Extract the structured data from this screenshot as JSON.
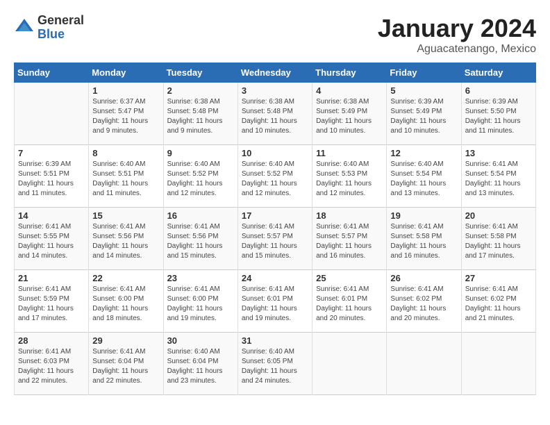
{
  "logo": {
    "general": "General",
    "blue": "Blue"
  },
  "header": {
    "month": "January 2024",
    "location": "Aguacatenango, Mexico"
  },
  "weekdays": [
    "Sunday",
    "Monday",
    "Tuesday",
    "Wednesday",
    "Thursday",
    "Friday",
    "Saturday"
  ],
  "weeks": [
    [
      {
        "day": "",
        "sunrise": "",
        "sunset": "",
        "daylight": ""
      },
      {
        "day": "1",
        "sunrise": "Sunrise: 6:37 AM",
        "sunset": "Sunset: 5:47 PM",
        "daylight": "Daylight: 11 hours and 9 minutes."
      },
      {
        "day": "2",
        "sunrise": "Sunrise: 6:38 AM",
        "sunset": "Sunset: 5:48 PM",
        "daylight": "Daylight: 11 hours and 9 minutes."
      },
      {
        "day": "3",
        "sunrise": "Sunrise: 6:38 AM",
        "sunset": "Sunset: 5:48 PM",
        "daylight": "Daylight: 11 hours and 10 minutes."
      },
      {
        "day": "4",
        "sunrise": "Sunrise: 6:38 AM",
        "sunset": "Sunset: 5:49 PM",
        "daylight": "Daylight: 11 hours and 10 minutes."
      },
      {
        "day": "5",
        "sunrise": "Sunrise: 6:39 AM",
        "sunset": "Sunset: 5:49 PM",
        "daylight": "Daylight: 11 hours and 10 minutes."
      },
      {
        "day": "6",
        "sunrise": "Sunrise: 6:39 AM",
        "sunset": "Sunset: 5:50 PM",
        "daylight": "Daylight: 11 hours and 11 minutes."
      }
    ],
    [
      {
        "day": "7",
        "sunrise": "Sunrise: 6:39 AM",
        "sunset": "Sunset: 5:51 PM",
        "daylight": "Daylight: 11 hours and 11 minutes."
      },
      {
        "day": "8",
        "sunrise": "Sunrise: 6:40 AM",
        "sunset": "Sunset: 5:51 PM",
        "daylight": "Daylight: 11 hours and 11 minutes."
      },
      {
        "day": "9",
        "sunrise": "Sunrise: 6:40 AM",
        "sunset": "Sunset: 5:52 PM",
        "daylight": "Daylight: 11 hours and 12 minutes."
      },
      {
        "day": "10",
        "sunrise": "Sunrise: 6:40 AM",
        "sunset": "Sunset: 5:52 PM",
        "daylight": "Daylight: 11 hours and 12 minutes."
      },
      {
        "day": "11",
        "sunrise": "Sunrise: 6:40 AM",
        "sunset": "Sunset: 5:53 PM",
        "daylight": "Daylight: 11 hours and 12 minutes."
      },
      {
        "day": "12",
        "sunrise": "Sunrise: 6:40 AM",
        "sunset": "Sunset: 5:54 PM",
        "daylight": "Daylight: 11 hours and 13 minutes."
      },
      {
        "day": "13",
        "sunrise": "Sunrise: 6:41 AM",
        "sunset": "Sunset: 5:54 PM",
        "daylight": "Daylight: 11 hours and 13 minutes."
      }
    ],
    [
      {
        "day": "14",
        "sunrise": "Sunrise: 6:41 AM",
        "sunset": "Sunset: 5:55 PM",
        "daylight": "Daylight: 11 hours and 14 minutes."
      },
      {
        "day": "15",
        "sunrise": "Sunrise: 6:41 AM",
        "sunset": "Sunset: 5:56 PM",
        "daylight": "Daylight: 11 hours and 14 minutes."
      },
      {
        "day": "16",
        "sunrise": "Sunrise: 6:41 AM",
        "sunset": "Sunset: 5:56 PM",
        "daylight": "Daylight: 11 hours and 15 minutes."
      },
      {
        "day": "17",
        "sunrise": "Sunrise: 6:41 AM",
        "sunset": "Sunset: 5:57 PM",
        "daylight": "Daylight: 11 hours and 15 minutes."
      },
      {
        "day": "18",
        "sunrise": "Sunrise: 6:41 AM",
        "sunset": "Sunset: 5:57 PM",
        "daylight": "Daylight: 11 hours and 16 minutes."
      },
      {
        "day": "19",
        "sunrise": "Sunrise: 6:41 AM",
        "sunset": "Sunset: 5:58 PM",
        "daylight": "Daylight: 11 hours and 16 minutes."
      },
      {
        "day": "20",
        "sunrise": "Sunrise: 6:41 AM",
        "sunset": "Sunset: 5:58 PM",
        "daylight": "Daylight: 11 hours and 17 minutes."
      }
    ],
    [
      {
        "day": "21",
        "sunrise": "Sunrise: 6:41 AM",
        "sunset": "Sunset: 5:59 PM",
        "daylight": "Daylight: 11 hours and 17 minutes."
      },
      {
        "day": "22",
        "sunrise": "Sunrise: 6:41 AM",
        "sunset": "Sunset: 6:00 PM",
        "daylight": "Daylight: 11 hours and 18 minutes."
      },
      {
        "day": "23",
        "sunrise": "Sunrise: 6:41 AM",
        "sunset": "Sunset: 6:00 PM",
        "daylight": "Daylight: 11 hours and 19 minutes."
      },
      {
        "day": "24",
        "sunrise": "Sunrise: 6:41 AM",
        "sunset": "Sunset: 6:01 PM",
        "daylight": "Daylight: 11 hours and 19 minutes."
      },
      {
        "day": "25",
        "sunrise": "Sunrise: 6:41 AM",
        "sunset": "Sunset: 6:01 PM",
        "daylight": "Daylight: 11 hours and 20 minutes."
      },
      {
        "day": "26",
        "sunrise": "Sunrise: 6:41 AM",
        "sunset": "Sunset: 6:02 PM",
        "daylight": "Daylight: 11 hours and 20 minutes."
      },
      {
        "day": "27",
        "sunrise": "Sunrise: 6:41 AM",
        "sunset": "Sunset: 6:02 PM",
        "daylight": "Daylight: 11 hours and 21 minutes."
      }
    ],
    [
      {
        "day": "28",
        "sunrise": "Sunrise: 6:41 AM",
        "sunset": "Sunset: 6:03 PM",
        "daylight": "Daylight: 11 hours and 22 minutes."
      },
      {
        "day": "29",
        "sunrise": "Sunrise: 6:41 AM",
        "sunset": "Sunset: 6:04 PM",
        "daylight": "Daylight: 11 hours and 22 minutes."
      },
      {
        "day": "30",
        "sunrise": "Sunrise: 6:40 AM",
        "sunset": "Sunset: 6:04 PM",
        "daylight": "Daylight: 11 hours and 23 minutes."
      },
      {
        "day": "31",
        "sunrise": "Sunrise: 6:40 AM",
        "sunset": "Sunset: 6:05 PM",
        "daylight": "Daylight: 11 hours and 24 minutes."
      },
      {
        "day": "",
        "sunrise": "",
        "sunset": "",
        "daylight": ""
      },
      {
        "day": "",
        "sunrise": "",
        "sunset": "",
        "daylight": ""
      },
      {
        "day": "",
        "sunrise": "",
        "sunset": "",
        "daylight": ""
      }
    ]
  ]
}
